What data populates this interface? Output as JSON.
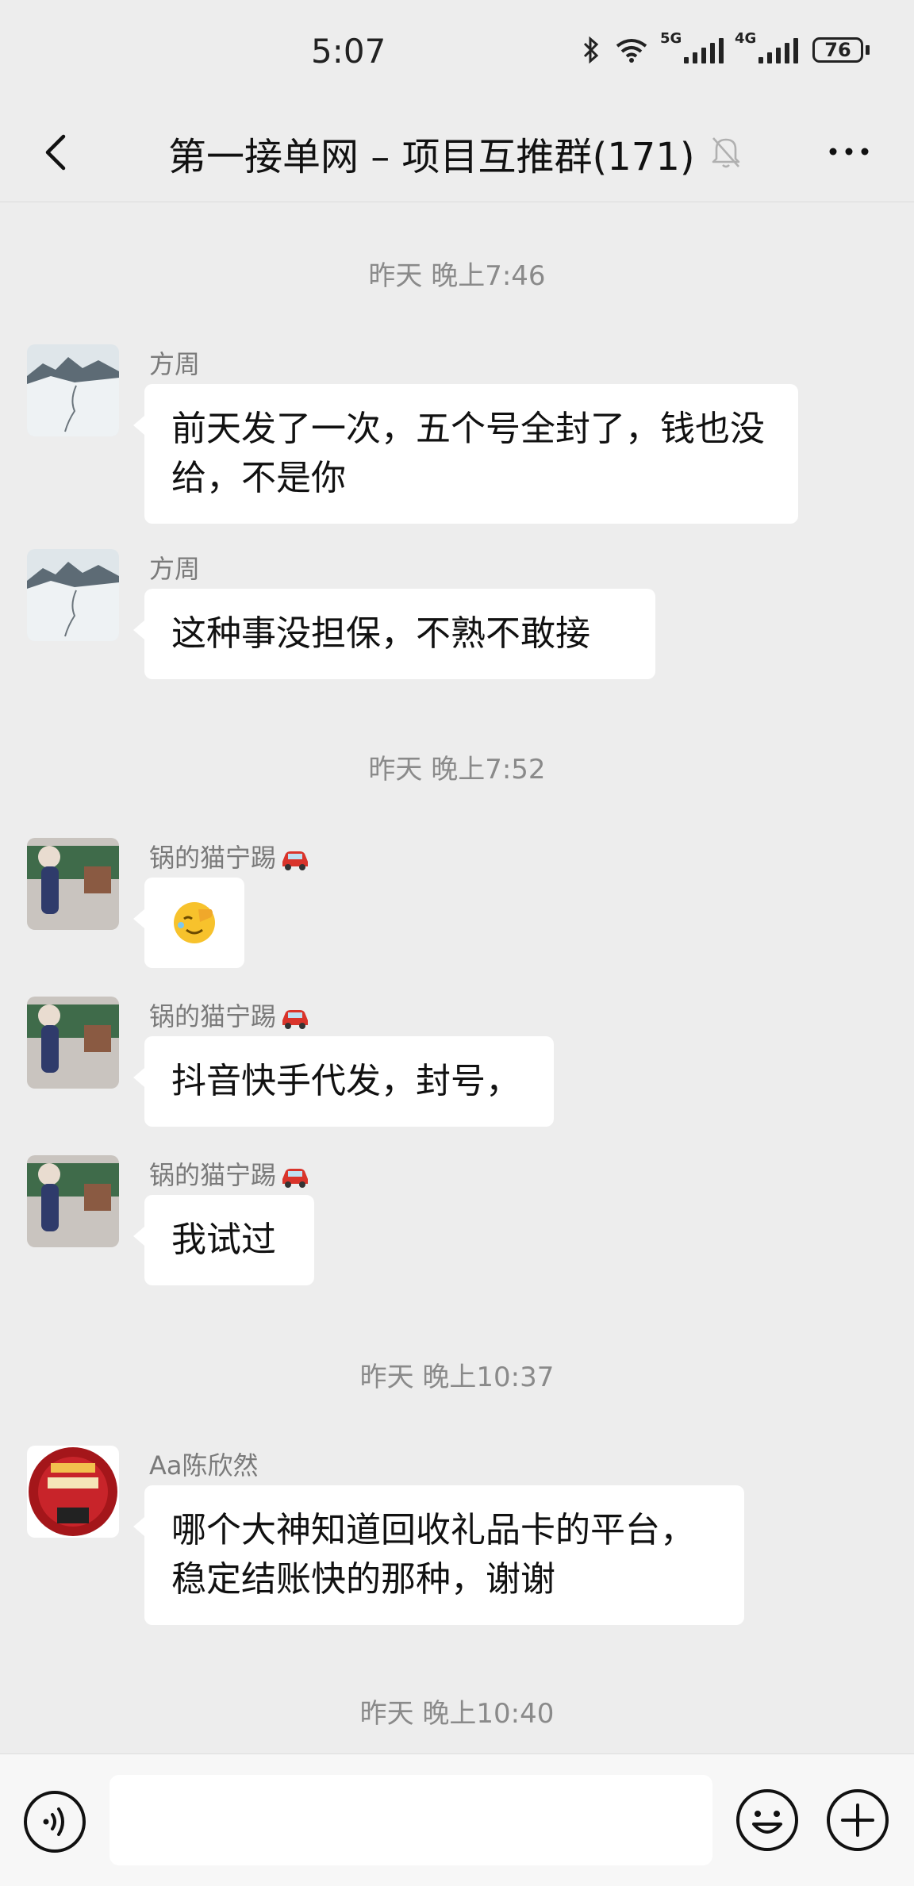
{
  "status": {
    "time": "5:07",
    "net1": "5G",
    "net2": "4G",
    "battery": "76"
  },
  "header": {
    "title": "第一接单网 – 项目互推群(171)"
  },
  "timestamps": [
    "昨天 晚上7:46",
    "昨天 晚上7:52",
    "昨天 晚上10:37",
    "昨天 晚上10:40"
  ],
  "messages": [
    {
      "sender": "方周",
      "text": "前天发了一次，五个号全封了，钱也没给，不是你"
    },
    {
      "sender": "方周",
      "text": "这种事没担保，不熟不敢接"
    },
    {
      "sender": "锅的猫宁踢",
      "text": ""
    },
    {
      "sender": "锅的猫宁踢",
      "text": "抖音快手代发，封号，"
    },
    {
      "sender": "锅的猫宁踢",
      "text": "我试过"
    },
    {
      "sender": "Aa陈欣然",
      "text": "哪个大神知道回收礼品卡的平台，稳定结账快的那种，谢谢"
    }
  ],
  "icons": {
    "back": "back-icon",
    "mute": "mute-bell-icon",
    "more": "more-icon",
    "voice": "voice-icon",
    "emoji": "emoji-icon",
    "plus": "plus-icon",
    "facepalm": "facepalm-emoji-icon",
    "car": "car-emoji-icon"
  },
  "input": {
    "value": ""
  },
  "colors": {
    "background": "#ededed",
    "bubble": "#ffffff",
    "meta_text": "#8a8a8a"
  }
}
